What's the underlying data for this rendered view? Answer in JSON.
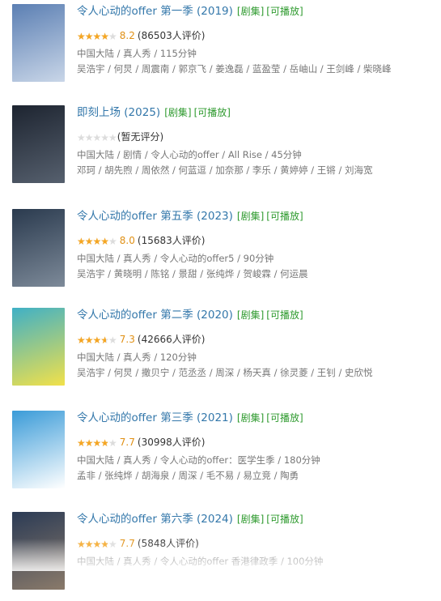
{
  "items": [
    {
      "title": "令人心动的offer 第一季 (2019)",
      "tag_series": "[剧集]",
      "tag_play": "[可播放]",
      "rating": 0.82,
      "score": "8.2",
      "count": "(86503人评价)",
      "meta": "中国大陆 / 真人秀 / 115分钟",
      "cast": "吴浩宇 / 何炅 / 周震南 / 郭京飞 / 姜逸磊 / 蓝盈莹 / 岳岫山 / 王剑峰 / 柴晓峰",
      "poster_colors": [
        "#5b7fb3",
        "#c9d6e8"
      ]
    },
    {
      "title": "即刻上场 (2025)",
      "tag_series": "[剧集]",
      "tag_play": "[可播放]",
      "rating": 0,
      "score": "",
      "count": "(暂无评分)",
      "meta": "中国大陆 / 剧情 / 令人心动的offer / All Rise / 45分钟",
      "cast": "邓珂 / 胡先煦 / 周依然 / 何蓝逗 / 加奈那 / 李乐 / 黄婷婷 / 王锵 / 刘海宽",
      "poster_colors": [
        "#1d2430",
        "#56606e"
      ]
    },
    {
      "title": "令人心动的offer 第五季 (2023)",
      "tag_series": "[剧集]",
      "tag_play": "[可播放]",
      "rating": 0.8,
      "score": "8.0",
      "count": "(15683人评价)",
      "meta": "中国大陆 / 真人秀 / 令人心动的offer5 / 90分钟",
      "cast": "吴浩宇 / 黄晓明 / 陈铭 / 景甜 / 张纯烨 / 贺峻霖 / 何运晨",
      "poster_colors": [
        "#2a3a4e",
        "#7d8a99"
      ]
    },
    {
      "title": "令人心动的offer 第二季 (2020)",
      "tag_series": "[剧集]",
      "tag_play": "[可播放]",
      "rating": 0.73,
      "score": "7.3",
      "count": "(42666人评价)",
      "meta": "中国大陆 / 真人秀 / 120分钟",
      "cast": "吴浩宇 / 何炅 / 撒贝宁 / 范丞丞 / 周深 / 杨天真 / 徐灵菱 / 王钊 / 史欣悦",
      "poster_colors": [
        "#3fb0c6",
        "#f2e14a"
      ]
    },
    {
      "title": "令人心动的offer 第三季 (2021)",
      "tag_series": "[剧集]",
      "tag_play": "[可播放]",
      "rating": 0.77,
      "score": "7.7",
      "count": "(30998人评价)",
      "meta": "中国大陆 / 真人秀 / 令人心动的offer：医学生季 / 180分钟",
      "cast": "孟非 / 张纯烨 / 胡海泉 / 周深 / 毛不易 / 易立竞 / 陶勇",
      "poster_colors": [
        "#3a9bd8",
        "#ffffff"
      ]
    },
    {
      "title": "令人心动的offer 第六季 (2024)",
      "tag_series": "[剧集]",
      "tag_play": "[可播放]",
      "rating": 0.77,
      "score": "7.7",
      "count": "(5848人评价)",
      "meta": "中国大陆 / 真人秀 / 令人心动的offer 香港律政季 / 100分钟",
      "cast": "",
      "poster_colors": [
        "#2b3b55",
        "#8a7a6a"
      ]
    }
  ]
}
